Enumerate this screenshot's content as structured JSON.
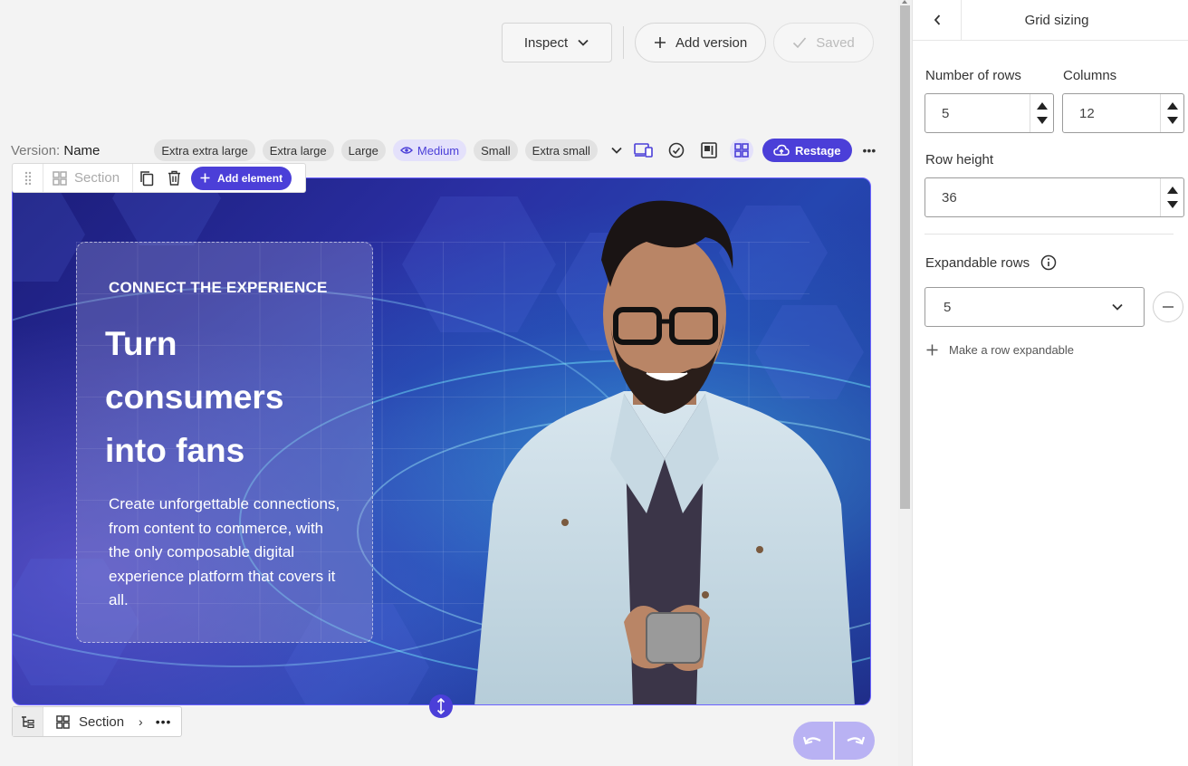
{
  "top_actions": {
    "inspect_label": "Inspect",
    "add_version_label": "Add version",
    "saved_label": "Saved"
  },
  "version": {
    "prefix": "Version:",
    "name": "Name"
  },
  "breakpoints": [
    {
      "label": "Extra extra large"
    },
    {
      "label": "Extra large"
    },
    {
      "label": "Large"
    },
    {
      "label": "Medium",
      "active": true
    },
    {
      "label": "Small"
    },
    {
      "label": "Extra small"
    }
  ],
  "toolbar": {
    "restage_label": "Restage",
    "more_label": "•••"
  },
  "section_toolbar": {
    "section_label": "Section",
    "add_element_label": "Add element"
  },
  "hero": {
    "eyebrow": "CONNECT THE EXPERIENCE",
    "headline_lines": [
      "Turn",
      "consumers",
      "into fans"
    ],
    "body": "Create unforgettable connections, from content to commerce, with the only composable digital experience platform that covers it all."
  },
  "breadcrumb": {
    "section_label": "Section",
    "chevron": "›",
    "more": "•••"
  },
  "panel": {
    "title": "Grid sizing",
    "rows_label": "Number of rows",
    "rows_value": "5",
    "columns_label": "Columns",
    "columns_value": "12",
    "row_height_label": "Row height",
    "row_height_value": "36",
    "expandable_label": "Expandable rows",
    "expandable_value": "5",
    "make_expandable_label": "Make a row expandable"
  },
  "colors": {
    "accent": "#4b3fd8",
    "accent_soft": "#e4e1fb",
    "undo_redo": "#b9b2f3"
  },
  "icons": [
    "chevron-down-icon",
    "plus-icon",
    "check-icon",
    "eye-icon",
    "device-icon",
    "check-circle-icon",
    "preview-icon",
    "grid-icon",
    "cloud-upload-icon",
    "drag-grip-icon",
    "section-grid-icon",
    "copy-icon",
    "trash-icon",
    "resize-vertical-icon",
    "tree-icon",
    "undo-icon",
    "redo-icon",
    "back-chevron-icon",
    "info-icon",
    "minus-icon"
  ]
}
